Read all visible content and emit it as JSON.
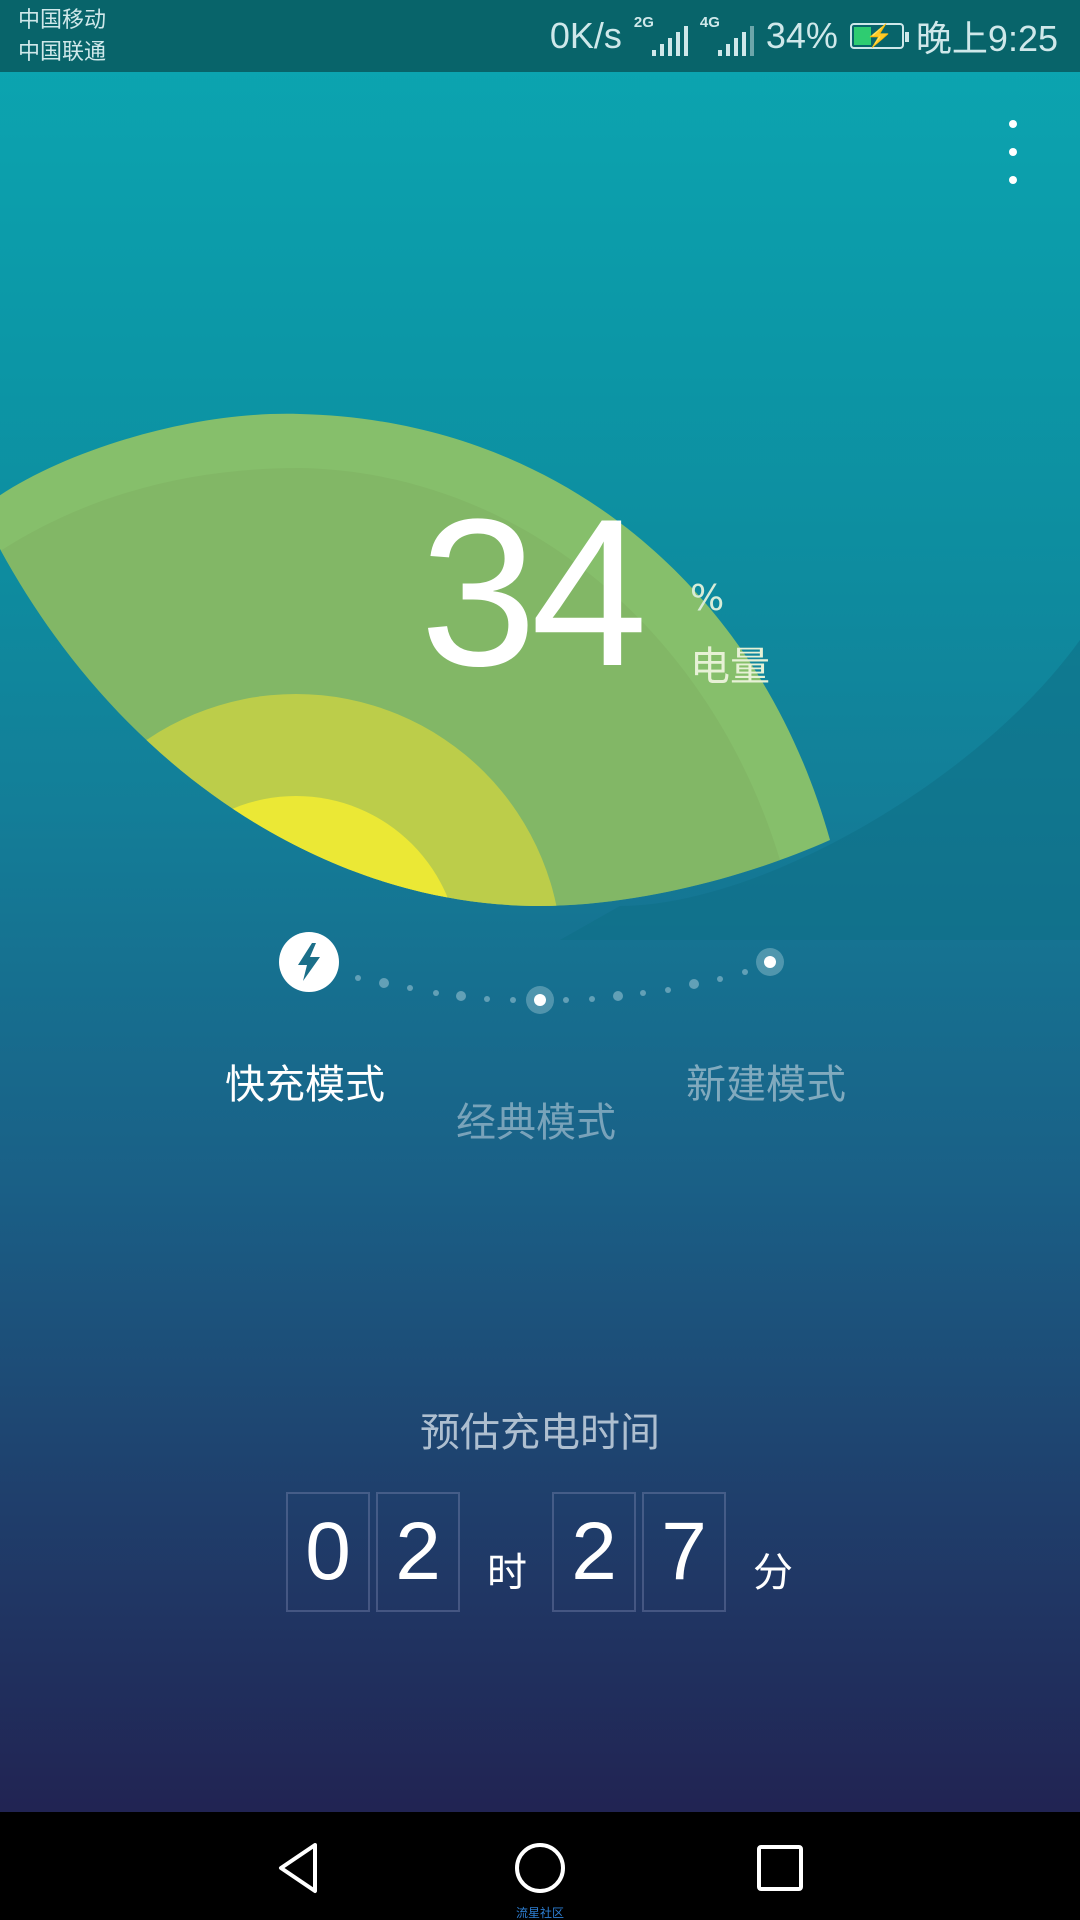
{
  "status_bar": {
    "carrier_1": "中国移动",
    "carrier_2": "中国联通",
    "speed": "0K/s",
    "sim1_type": "2G",
    "sim2_type": "4G",
    "battery_percent": "34%",
    "time": "晚上9:25",
    "icons": [
      "signal-2g-icon",
      "signal-4g-icon",
      "battery-charging-icon"
    ]
  },
  "battery": {
    "level": "34",
    "percent_sign": "%",
    "label": "电量"
  },
  "modes": {
    "fast": "快充模式",
    "classic": "经典模式",
    "new": "新建模式",
    "selected": "fast"
  },
  "estimate": {
    "title": "预估充电时间",
    "hour_digit_1": "0",
    "hour_digit_2": "2",
    "hour_unit": "时",
    "minute_digit_1": "2",
    "minute_digit_2": "7",
    "minute_unit": "分"
  },
  "navbar": {
    "icons": [
      "back-icon",
      "home-icon",
      "recents-icon"
    ],
    "caption": "流星社区"
  },
  "colors": {
    "leaf_outer": "#86bf6b",
    "leaf_mid": "#bccd4a",
    "leaf_inner": "#ebe835",
    "statusbar": "#08646a"
  }
}
